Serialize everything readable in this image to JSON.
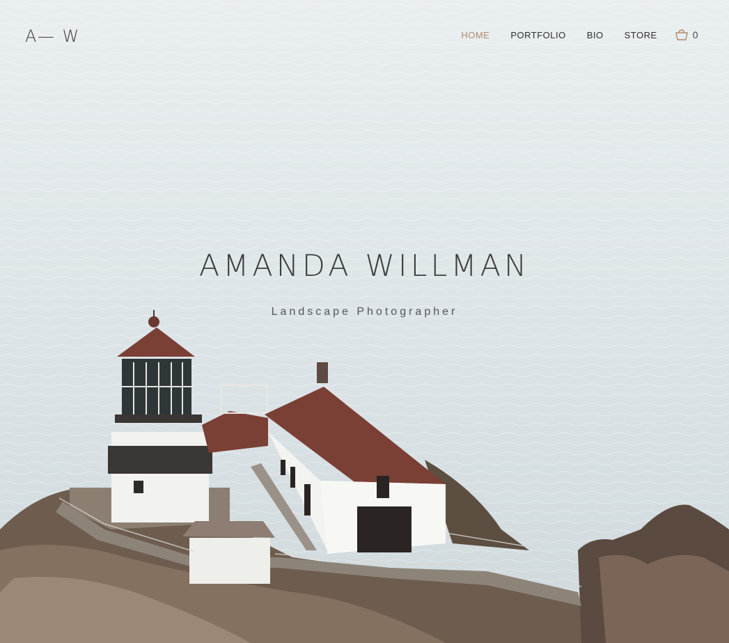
{
  "site": {
    "logo": "A— W",
    "title": "AMANDA WILLMAN",
    "subtitle": "Landscape Photographer"
  },
  "nav": {
    "items": [
      {
        "label": "HOME",
        "active": true
      },
      {
        "label": "PORTFOLIO",
        "active": false
      },
      {
        "label": "BIO",
        "active": false
      },
      {
        "label": "STORE",
        "active": false
      }
    ],
    "cart_count": "0",
    "cart_icon": "shopping-basket-icon"
  },
  "colors": {
    "accent": "#b08a6a",
    "text": "#3d3d3d",
    "sea": "#dfe6e8",
    "rock": "#6b5a4c",
    "roof": "#7a3f35"
  }
}
